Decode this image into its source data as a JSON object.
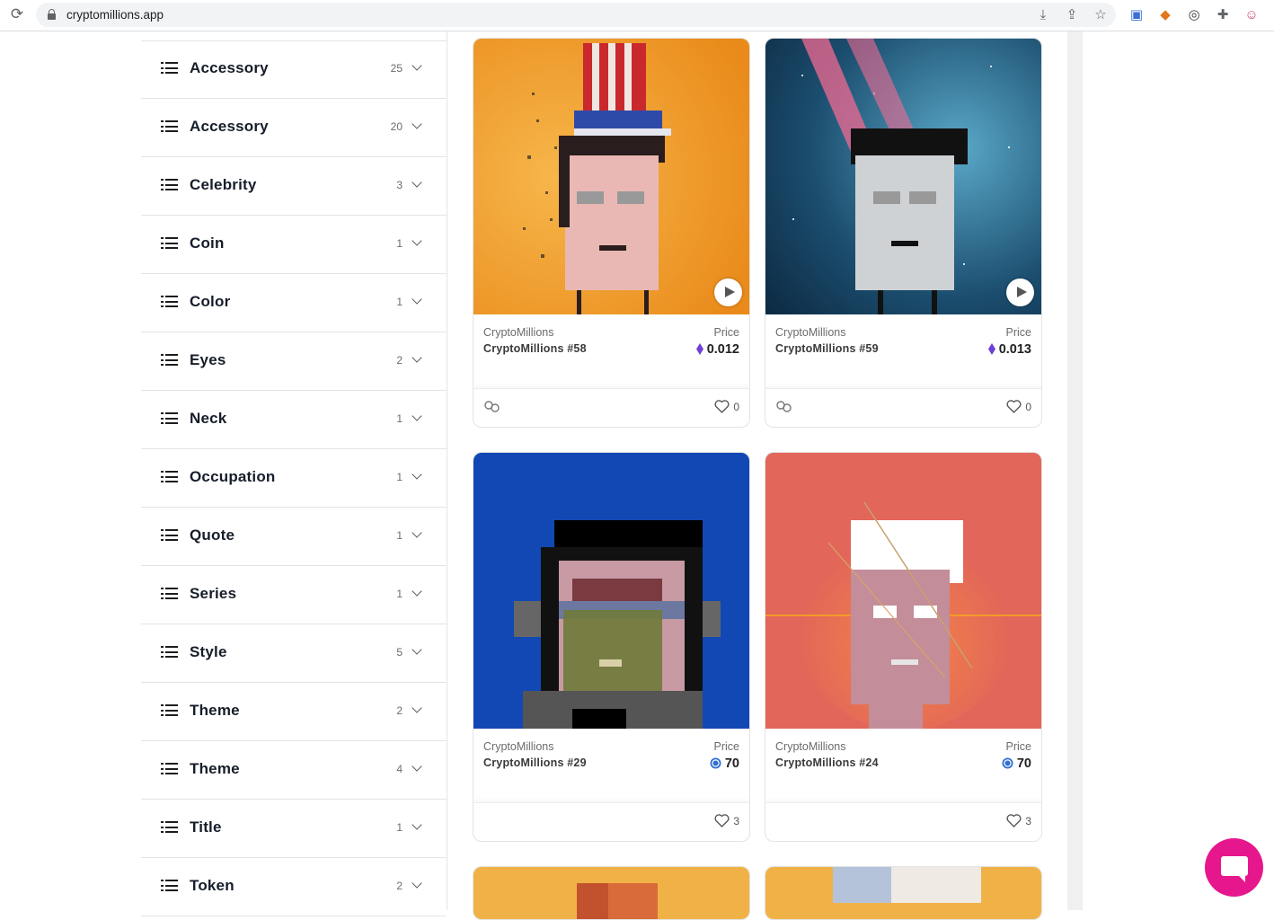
{
  "browser": {
    "url": "cryptomillions.app"
  },
  "filters": [
    {
      "label": "Accessory",
      "count": "25"
    },
    {
      "label": "Accessory",
      "count": "20"
    },
    {
      "label": "Celebrity",
      "count": "3"
    },
    {
      "label": "Coin",
      "count": "1"
    },
    {
      "label": "Color",
      "count": "1"
    },
    {
      "label": "Eyes",
      "count": "2"
    },
    {
      "label": "Neck",
      "count": "1"
    },
    {
      "label": "Occupation",
      "count": "1"
    },
    {
      "label": "Quote",
      "count": "1"
    },
    {
      "label": "Series",
      "count": "1"
    },
    {
      "label": "Style",
      "count": "5"
    },
    {
      "label": "Theme",
      "count": "2"
    },
    {
      "label": "Theme",
      "count": "4"
    },
    {
      "label": "Title",
      "count": "1"
    },
    {
      "label": "Token",
      "count": "2"
    }
  ],
  "cards": [
    {
      "collection": "CryptoMillions",
      "name": "CryptoMillions #58",
      "price_label": "Price",
      "price": "0.012",
      "currency_icon": "ethereum-icon",
      "likes": "0",
      "has_play": true,
      "has_link": true
    },
    {
      "collection": "CryptoMillions",
      "name": "CryptoMillions #59",
      "price_label": "Price",
      "price": "0.013",
      "currency_icon": "ethereum-icon",
      "likes": "0",
      "has_play": true,
      "has_link": true
    },
    {
      "collection": "CryptoMillions",
      "name": "CryptoMillions #29",
      "price_label": "Price",
      "price": "70",
      "currency_icon": "coin-token-icon",
      "likes": "3",
      "has_play": false,
      "has_link": false
    },
    {
      "collection": "CryptoMillions",
      "name": "CryptoMillions #24",
      "price_label": "Price",
      "price": "70",
      "currency_icon": "coin-token-icon",
      "likes": "3",
      "has_play": false,
      "has_link": false
    }
  ],
  "colors": {
    "accent": "#e6178c",
    "eth": "#6f3fd6",
    "token": "#2f6fd1"
  }
}
